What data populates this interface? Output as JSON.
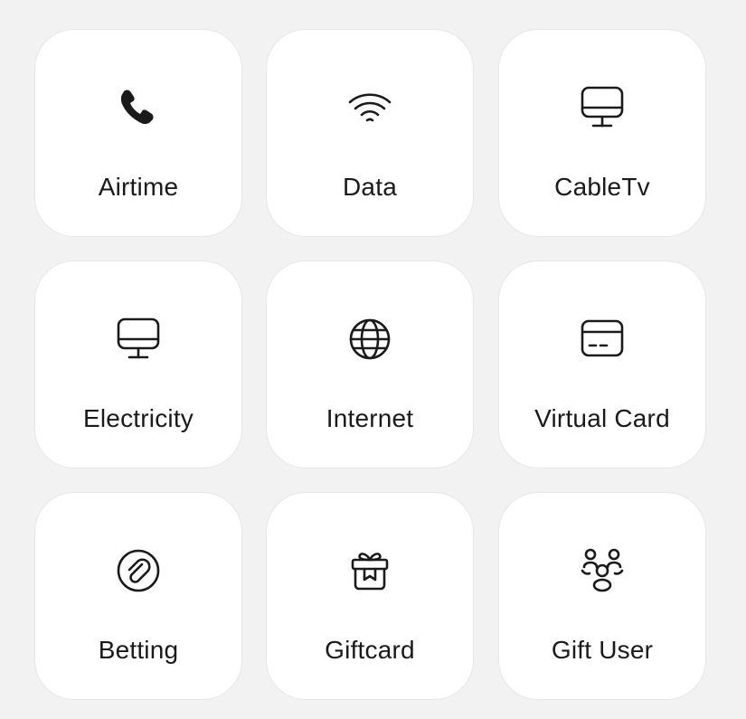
{
  "services": [
    {
      "label": "Airtime",
      "icon": "phone-icon"
    },
    {
      "label": "Data",
      "icon": "wifi-icon"
    },
    {
      "label": "CableTv",
      "icon": "monitor-icon"
    },
    {
      "label": "Electricity",
      "icon": "monitor-icon"
    },
    {
      "label": "Internet",
      "icon": "globe-icon"
    },
    {
      "label": "Virtual Card",
      "icon": "card-icon"
    },
    {
      "label": "Betting",
      "icon": "paperclip-circle-icon"
    },
    {
      "label": "Giftcard",
      "icon": "gift-icon"
    },
    {
      "label": "Gift User",
      "icon": "users-icon"
    }
  ],
  "colors": {
    "background": "#f2f2f2",
    "tile": "#ffffff",
    "text": "#1a1a1a"
  }
}
